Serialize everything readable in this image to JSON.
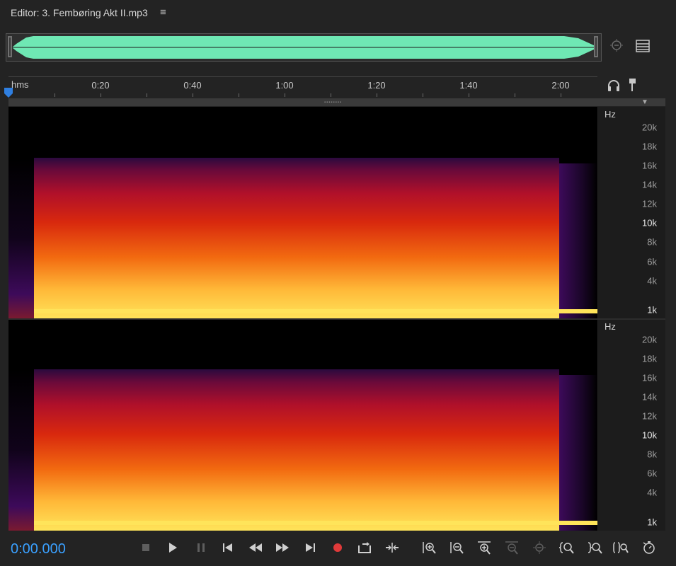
{
  "editor": {
    "title": "Editor: 3. Fembøring Akt II.mp3",
    "menu_icon": "hamburger-menu-icon"
  },
  "overview": {
    "waveform_color": "#6fe8b4",
    "icons": [
      "zoom-to-selection-icon",
      "panel-menu-icon"
    ]
  },
  "ruler": {
    "unit_label": "hms",
    "ticks": [
      "0:20",
      "0:40",
      "1:00",
      "1:20",
      "1:40",
      "2:00"
    ],
    "icons": [
      "headphones-icon",
      "pin-marker-icon"
    ]
  },
  "spectral_display": {
    "unit": "Hz",
    "frequency_labels": [
      "20k",
      "18k",
      "16k",
      "14k",
      "12k",
      "10k",
      "8k",
      "6k",
      "4k",
      "1k"
    ],
    "highlighted_labels": [
      "10k",
      "1k"
    ],
    "channels": [
      "left",
      "right"
    ],
    "colors": {
      "high": "#ffe45a",
      "mid": "#ff6a00",
      "low": "#b0002a",
      "faint": "#3d0a5a",
      "background": "#000000"
    }
  },
  "transport": {
    "time": "0:00.000",
    "time_color": "#3aa0ff",
    "record_color": "#e03a3a",
    "buttons": [
      "stop-icon",
      "play-icon",
      "pause-icon",
      "skip-to-start-icon",
      "rewind-icon",
      "fast-forward-icon",
      "skip-to-end-icon",
      "record-icon",
      "loop-playback-icon",
      "skip-selection-icon"
    ],
    "zoom_buttons": [
      "zoom-in-amplitude-icon",
      "zoom-out-amplitude-icon",
      "zoom-in-time-icon",
      "zoom-out-time-icon",
      "zoom-out-full-icon",
      "zoom-in-at-start-icon",
      "zoom-in-at-end-icon",
      "zoom-to-selection-icon",
      "zoom-reset-icon"
    ]
  }
}
